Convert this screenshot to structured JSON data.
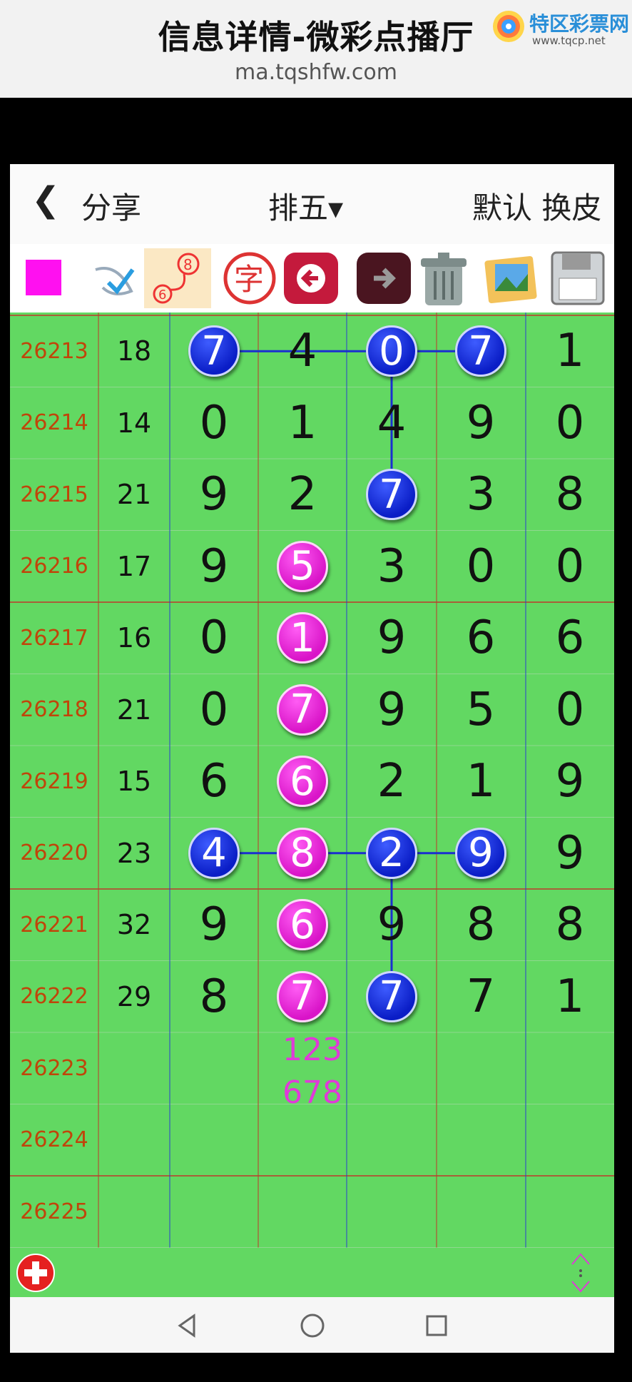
{
  "header": {
    "title": "信息详情-微彩点播厅",
    "url": "ma.tqshfw.com",
    "brand_name": "特区彩票网",
    "brand_url": "www.tqcp.net"
  },
  "topbar": {
    "back_icon": "chevron-left-icon",
    "share_label": "分享",
    "lottery_label": "排五▾",
    "skin_label": "默认 换皮"
  },
  "toolbar": [
    "magenta-color-swatch",
    "pen-icon",
    "link-8-6-icon",
    "zi-text-icon",
    "back-arrow-icon",
    "forward-arrow-icon",
    "trash-icon",
    "picture-icon",
    "save-floppy-icon"
  ],
  "colors": {
    "pink_ball": "#e020d6",
    "blue_ball": "#1225d9",
    "issue_text": "#c0450a",
    "background": "#62d862"
  },
  "rows": [
    {
      "issue": "26213",
      "sum": "18",
      "digits": [
        "7",
        "4",
        "0",
        "7",
        "1"
      ]
    },
    {
      "issue": "26214",
      "sum": "14",
      "digits": [
        "0",
        "1",
        "4",
        "9",
        "0"
      ]
    },
    {
      "issue": "26215",
      "sum": "21",
      "digits": [
        "9",
        "2",
        "7",
        "3",
        "8"
      ]
    },
    {
      "issue": "26216",
      "sum": "17",
      "digits": [
        "9",
        "5",
        "3",
        "0",
        "0"
      ]
    },
    {
      "issue": "26217",
      "sum": "16",
      "digits": [
        "0",
        "1",
        "9",
        "6",
        "6"
      ]
    },
    {
      "issue": "26218",
      "sum": "21",
      "digits": [
        "0",
        "7",
        "9",
        "5",
        "0"
      ]
    },
    {
      "issue": "26219",
      "sum": "15",
      "digits": [
        "6",
        "6",
        "2",
        "1",
        "9"
      ]
    },
    {
      "issue": "26220",
      "sum": "23",
      "digits": [
        "4",
        "8",
        "2",
        "9",
        "9"
      ]
    },
    {
      "issue": "26221",
      "sum": "32",
      "digits": [
        "9",
        "6",
        "9",
        "8",
        "8"
      ]
    },
    {
      "issue": "26222",
      "sum": "29",
      "digits": [
        "8",
        "7",
        "7",
        "7",
        "1"
      ]
    },
    {
      "issue": "26223",
      "sum": "",
      "digits": [
        "",
        "",
        "",
        "",
        ""
      ]
    },
    {
      "issue": "26224",
      "sum": "",
      "digits": [
        "",
        "",
        "",
        "",
        ""
      ]
    },
    {
      "issue": "26225",
      "sum": "",
      "digits": [
        "",
        "",
        "",
        "",
        ""
      ]
    }
  ],
  "highlights": [
    {
      "row": 0,
      "col": 0,
      "color": "blue"
    },
    {
      "row": 0,
      "col": 2,
      "color": "blue"
    },
    {
      "row": 0,
      "col": 3,
      "color": "blue"
    },
    {
      "row": 2,
      "col": 2,
      "color": "blue"
    },
    {
      "row": 3,
      "col": 1,
      "color": "pink"
    },
    {
      "row": 4,
      "col": 1,
      "color": "pink"
    },
    {
      "row": 5,
      "col": 1,
      "color": "pink"
    },
    {
      "row": 6,
      "col": 1,
      "color": "pink"
    },
    {
      "row": 7,
      "col": 1,
      "color": "pink"
    },
    {
      "row": 8,
      "col": 1,
      "color": "pink"
    },
    {
      "row": 9,
      "col": 1,
      "color": "pink"
    },
    {
      "row": 7,
      "col": 0,
      "color": "blue"
    },
    {
      "row": 7,
      "col": 2,
      "color": "blue"
    },
    {
      "row": 7,
      "col": 3,
      "color": "blue"
    },
    {
      "row": 9,
      "col": 2,
      "color": "blue"
    }
  ],
  "prediction": {
    "line1": "123",
    "line2": "678"
  },
  "bottom": {
    "add_icon": "add-circle-icon",
    "scroll_icon": "scroll-updown-icon"
  },
  "navbar": [
    "back-triangle-icon",
    "home-circle-icon",
    "recents-square-icon"
  ]
}
